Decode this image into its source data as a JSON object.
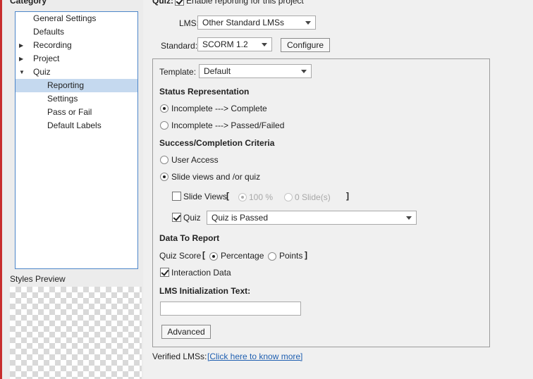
{
  "sidebar": {
    "header": "Category",
    "items": [
      {
        "label": "General Settings",
        "level": 0,
        "arrow": ""
      },
      {
        "label": "Defaults",
        "level": 0,
        "arrow": ""
      },
      {
        "label": "Recording",
        "level": 0,
        "arrow": "▶"
      },
      {
        "label": "Project",
        "level": 0,
        "arrow": "▶"
      },
      {
        "label": "Quiz",
        "level": 0,
        "arrow": "▼"
      },
      {
        "label": "Reporting",
        "level": 1,
        "arrow": ""
      },
      {
        "label": "Settings",
        "level": 1,
        "arrow": ""
      },
      {
        "label": "Pass or Fail",
        "level": 1,
        "arrow": ""
      },
      {
        "label": "Default Labels",
        "level": 1,
        "arrow": ""
      }
    ],
    "selected_index": 5,
    "styles_preview_label": "Styles Preview"
  },
  "quiz_header": {
    "label": "Quiz:",
    "enable_reporting_label": "Enable reporting for this project",
    "enable_reporting_checked": true
  },
  "lms": {
    "label": "LMS:",
    "value": "Other Standard LMSs"
  },
  "standard": {
    "label": "Standard:",
    "value": "SCORM 1.2",
    "configure_label": "Configure"
  },
  "template": {
    "label": "Template:",
    "value": "Default"
  },
  "status_representation": {
    "heading": "Status Representation",
    "options": [
      "Incomplete ---> Complete",
      "Incomplete ---> Passed/Failed"
    ],
    "selected": 0
  },
  "success_criteria": {
    "heading": "Success/Completion Criteria",
    "options": [
      "User Access",
      "Slide views and /or quiz"
    ],
    "selected": 1,
    "slide_views": {
      "label": "Slide Views",
      "checked": false,
      "bracket_open": "[",
      "bracket_close": "]",
      "percent_label": "100 %",
      "slides_label": "0 Slide(s)"
    },
    "quiz": {
      "label": "Quiz",
      "checked": true,
      "value": "Quiz is Passed"
    }
  },
  "data_to_report": {
    "heading": "Data To Report",
    "quiz_score_label": "Quiz Score",
    "bracket_open": "[",
    "bracket_close": "]",
    "percentage_label": "Percentage",
    "points_label": "Points",
    "score_selected": "percentage",
    "interaction_data_label": "Interaction Data",
    "interaction_data_checked": true
  },
  "lms_init": {
    "heading": "LMS Initialization Text:",
    "value": ""
  },
  "advanced_label": "Advanced",
  "verified": {
    "label": "Verified LMSs:",
    "link_text": "[Click here to know more]"
  }
}
